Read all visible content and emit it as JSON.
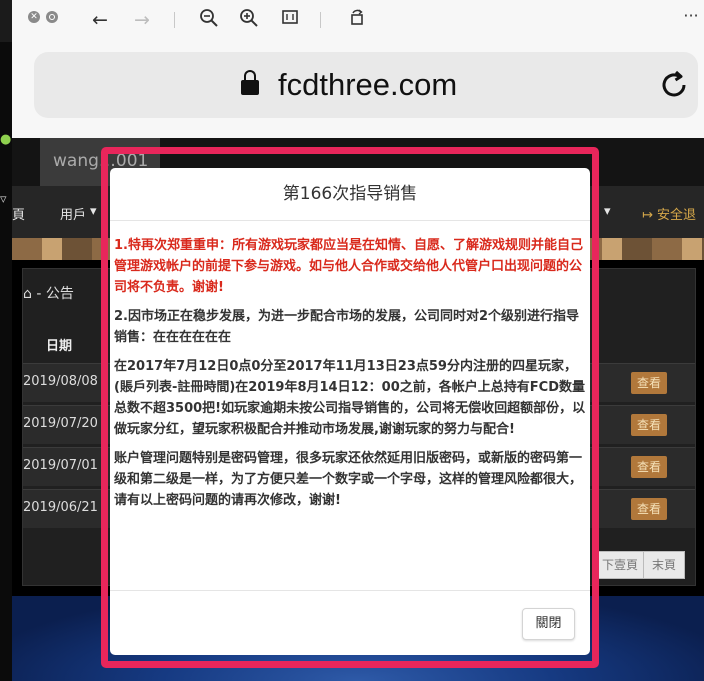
{
  "browser": {
    "url": "fcdthree.com",
    "more_menu": "···"
  },
  "page": {
    "username": "wang…001",
    "nav": {
      "home": "頁",
      "user": "用戶",
      "user_caret": "▾",
      "right_caret": "▾",
      "logout": "安全退"
    },
    "panel_title": "⌂ - 公告",
    "column_date": "日期",
    "rows": [
      {
        "date": "2019/08/08",
        "action": "查看"
      },
      {
        "date": "2019/07/20",
        "action": "查看"
      },
      {
        "date": "2019/07/01",
        "action": "查看"
      },
      {
        "date": "2019/06/21",
        "action": "查看"
      }
    ],
    "pagination": {
      "prev": "下壹頁",
      "last": "末頁"
    }
  },
  "modal": {
    "title": "第166次指导销售",
    "paragraphs": [
      "1.特再次郑重重申：所有游戏玩家都应当是在知情、自愿、了解游戏规则并能自己管理游戏帐户的前提下参与游戏。如与他人合作或交给他人代管户口出现问题的公司将不负责。谢谢!",
      "2.因市场正在稳步发展，为进一步配合市场的发展，公司同时对2个级别进行指导销售：在在在在在在",
      "在2017年7月12日0点0分至2017年11月13日23点59分内注册的四星玩家，(賬戶列表-註冊時間)在2019年8月14日12：00之前，各帐户上总持有FCD数量总数不超3500把!如玩家逾期未按公司指导销售的，公司将无偿收回超额部份，以做玩家分红，望玩家积极配合并推动市场发展,谢谢玩家的努力与配合!",
      "账户管理问题特别是密码管理，很多玩家还依然延用旧版密码，或新版的密码第一级和第二级是一样，为了方便只差一个数字或一个字母，这样的管理风险都很大，请有以上密码问题的请再次修改，谢谢!"
    ],
    "close_label": "關閉",
    "colors": {
      "warning": "#d9291c",
      "highlight": "#e8265b"
    }
  }
}
